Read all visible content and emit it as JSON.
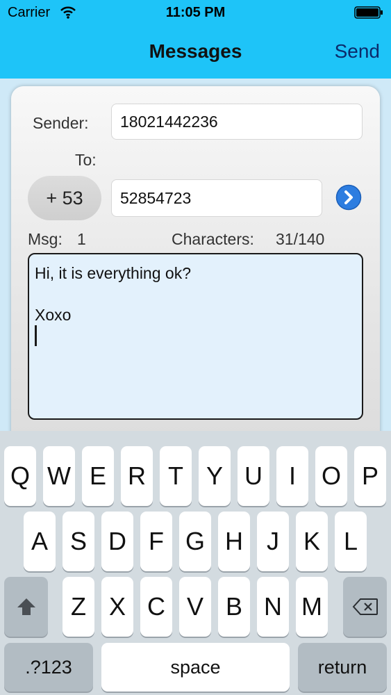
{
  "status_bar": {
    "carrier": "Carrier",
    "time": "11:05 PM"
  },
  "nav": {
    "title": "Messages",
    "send_label": "Send"
  },
  "form": {
    "sender_label": "Sender:",
    "sender_value": "18021442236",
    "to_label": "To:",
    "country_code": "+ 53",
    "to_value": "52854723",
    "msg_label": "Msg:",
    "msg_count": "1",
    "chars_label": "Characters:",
    "chars_value": "31/140",
    "message_lines": [
      "Hi, it is everything ok?",
      "",
      "Xoxo"
    ]
  },
  "keyboard": {
    "row1": [
      "Q",
      "W",
      "E",
      "R",
      "T",
      "Y",
      "U",
      "I",
      "O",
      "P"
    ],
    "row2": [
      "A",
      "S",
      "D",
      "F",
      "G",
      "H",
      "J",
      "K",
      "L"
    ],
    "row3": [
      "Z",
      "X",
      "C",
      "V",
      "B",
      "N",
      "M"
    ],
    "numbers_label": ".?123",
    "space_label": "space",
    "return_label": "return"
  },
  "icons": {
    "wifi": "wifi-icon",
    "battery": "battery-icon",
    "go": "chevron-right-circle-icon",
    "shift": "shift-icon",
    "delete": "backspace-icon"
  },
  "colors": {
    "header": "#1ec4f8",
    "nav_send": "#0b2b6b",
    "message_bg": "#e3f1fc",
    "go_button": "#2d7de0"
  }
}
